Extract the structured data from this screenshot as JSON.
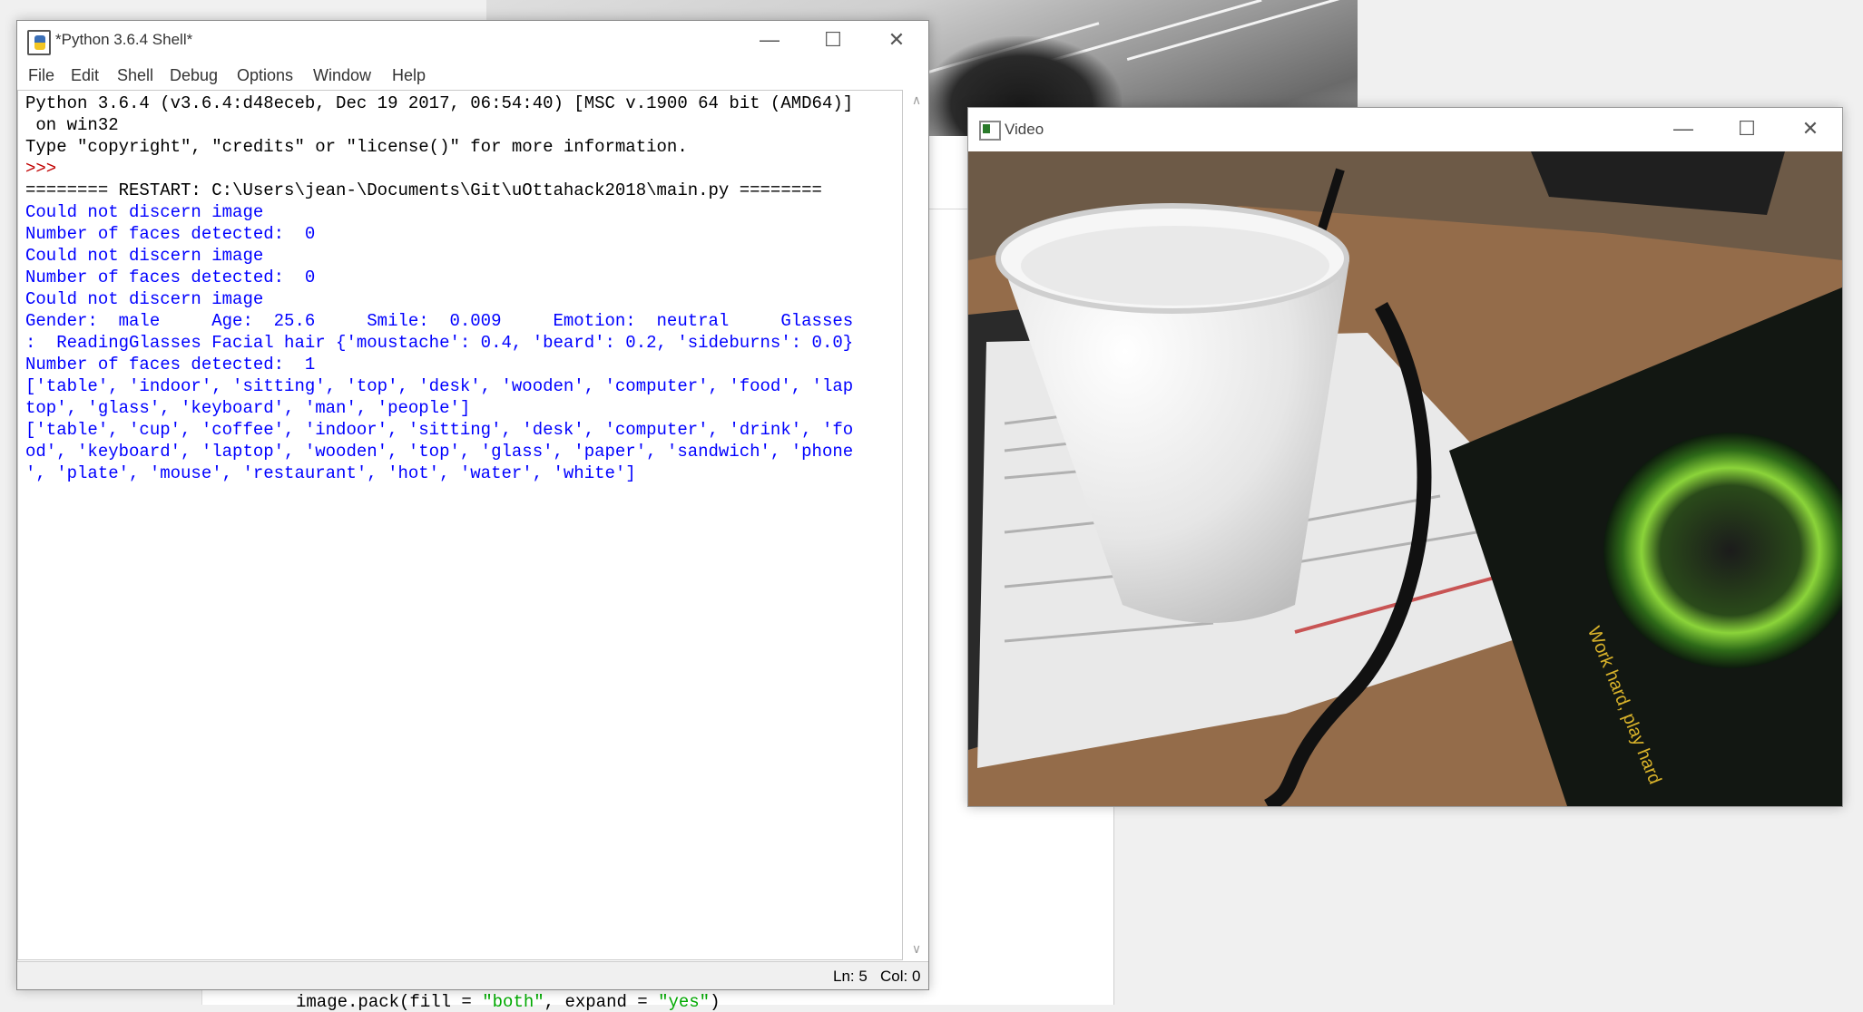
{
  "shell": {
    "title": "*Python 3.6.4 Shell*",
    "menu": [
      "File",
      "Edit",
      "Shell",
      "Debug",
      "Options",
      "Window",
      "Help"
    ],
    "lines": [
      {
        "text": "Python 3.6.4 (v3.6.4:d48eceb, Dec 19 2017, 06:54:40) [MSC v.1900 64 bit (AMD64)]",
        "color": "black"
      },
      {
        "text": " on win32",
        "color": "black"
      },
      {
        "text": "Type \"copyright\", \"credits\" or \"license()\" for more information.",
        "color": "black"
      },
      {
        "text": ">>> ",
        "color": "red"
      },
      {
        "text": "======== RESTART: C:\\Users\\jean-\\Documents\\Git\\uOttahack2018\\main.py ========",
        "color": "black"
      },
      {
        "text": "Could not discern image",
        "color": "blue"
      },
      {
        "text": "Number of faces detected:  0",
        "color": "blue"
      },
      {
        "text": "Could not discern image",
        "color": "blue"
      },
      {
        "text": "Number of faces detected:  0",
        "color": "blue"
      },
      {
        "text": "Could not discern image",
        "color": "blue"
      },
      {
        "text": "Gender:  male     Age:  25.6     Smile:  0.009     Emotion:  neutral     Glasses",
        "color": "blue"
      },
      {
        "text": ":  ReadingGlasses Facial hair {'moustache': 0.4, 'beard': 0.2, 'sideburns': 0.0}",
        "color": "blue"
      },
      {
        "text": "Number of faces detected:  1",
        "color": "blue"
      },
      {
        "text": "['table', 'indoor', 'sitting', 'top', 'desk', 'wooden', 'computer', 'food', 'lap",
        "color": "blue"
      },
      {
        "text": "top', 'glass', 'keyboard', 'man', 'people']",
        "color": "blue"
      },
      {
        "text": "['table', 'cup', 'coffee', 'indoor', 'sitting', 'desk', 'computer', 'drink', 'fo",
        "color": "blue"
      },
      {
        "text": "od', 'keyboard', 'laptop', 'wooden', 'top', 'glass', 'paper', 'sandwich', 'phone",
        "color": "blue"
      },
      {
        "text": "', 'plate', 'mouse', 'restaurant', 'hot', 'water', 'white']",
        "color": "blue"
      }
    ],
    "status": {
      "ln": "Ln: 5",
      "col": "Col: 0"
    }
  },
  "video": {
    "title": "Video"
  },
  "background_code": {
    "prefix": "image.pack(fill = ",
    "arg1": "\"both\"",
    "middle": ", expand = ",
    "arg2": "\"yes\"",
    "suffix": ")"
  },
  "icons": {
    "minimize": "minimize-icon",
    "maximize": "maximize-icon",
    "close": "close-icon"
  },
  "colors": {
    "output_blue": "#0000ff",
    "prompt_red": "#c00000",
    "code_green": "#00aa00"
  }
}
